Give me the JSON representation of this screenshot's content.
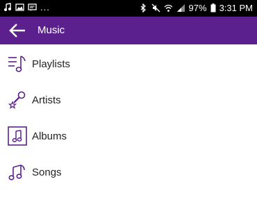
{
  "status_bar": {
    "left_icons": [
      "music-note-icon",
      "image-icon",
      "message-icon"
    ],
    "more_indicator": "...",
    "right_icons": [
      "bluetooth-icon",
      "mute-icon",
      "wifi-icon",
      "signal-icon",
      "battery-icon"
    ],
    "battery_percent": "97%",
    "time": "3:31 PM"
  },
  "app_bar": {
    "back_icon": "arrow-back-icon",
    "title": "Music",
    "color": "#5c1f8e"
  },
  "menu": {
    "accent_color": "#5c1f8e",
    "items": [
      {
        "label": "Playlists",
        "icon": "playlist-icon"
      },
      {
        "label": "Artists",
        "icon": "microphone-star-icon"
      },
      {
        "label": "Albums",
        "icon": "album-icon"
      },
      {
        "label": "Songs",
        "icon": "music-notes-icon"
      }
    ]
  }
}
